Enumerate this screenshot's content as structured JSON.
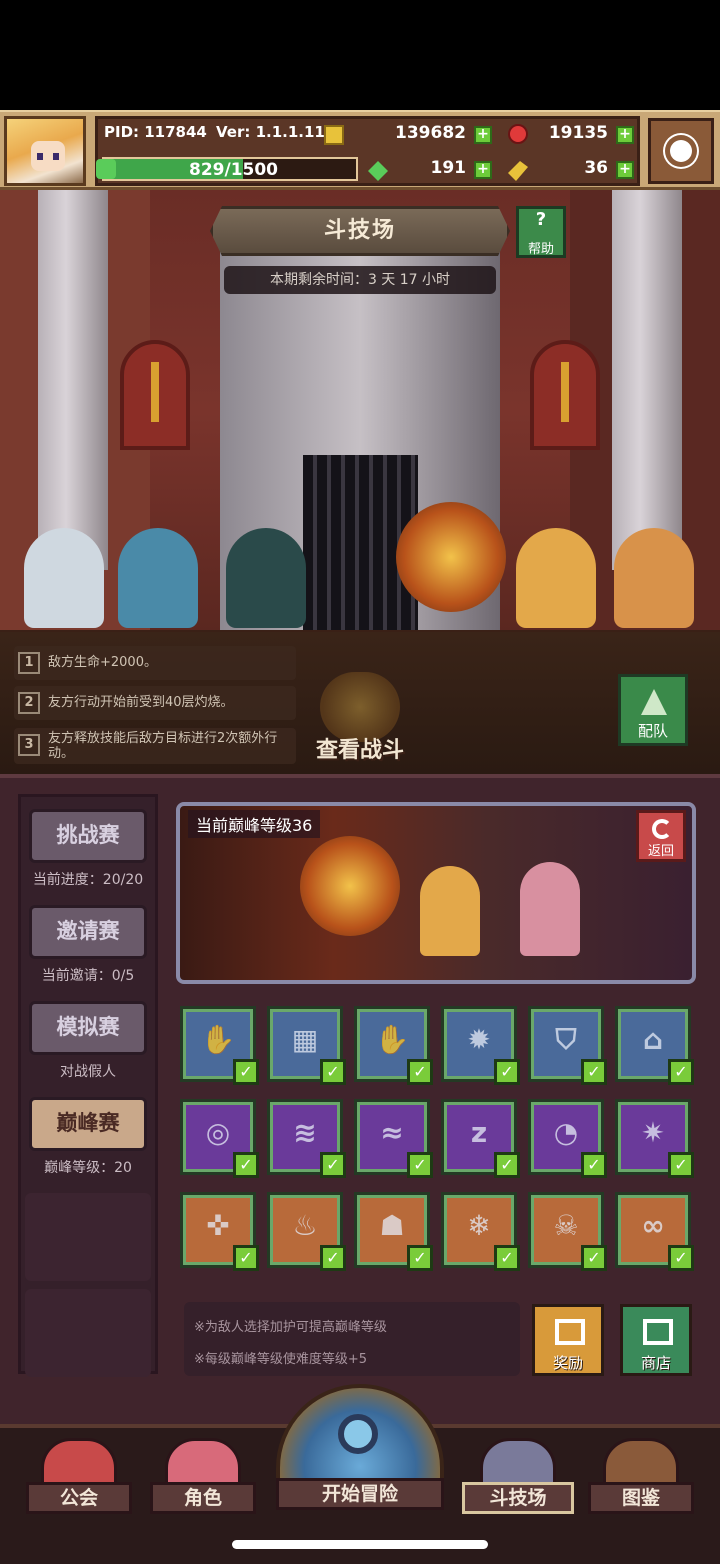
{
  "header": {
    "pid": "PID: 117844",
    "version": "Ver: 1.1.1.11",
    "gold": "139682",
    "gems": "19135",
    "energy": "829/1500",
    "energy_fraction": 0.553,
    "clovers": "191",
    "keys": "36",
    "colors": {
      "gold": "#e8c23a",
      "gem": "#e03a3a",
      "clover": "#5acc5a",
      "energy": "#3fa64a"
    }
  },
  "arena": {
    "title": "斗技场",
    "help_label": "帮助",
    "help_glyph": "?",
    "timer": "本期剩余时间：3 天 17 小时"
  },
  "modifiers": [
    {
      "num": "1",
      "text": "敌方生命+2000。"
    },
    {
      "num": "2",
      "text": "友方行动开始前受到40层灼烧。"
    },
    {
      "num": "3",
      "text": "友方释放技能后敌方目标进行2次额外行动。"
    }
  ],
  "watch_battle": "查看战斗",
  "team_label": "配队",
  "modes": [
    {
      "label": "挑战赛",
      "sub": "当前进度：20/20"
    },
    {
      "label": "邀请赛",
      "sub": "当前邀请：0/5"
    },
    {
      "label": "模拟赛",
      "sub": "对战假人"
    },
    {
      "label": "巅峰赛",
      "sub": "巅峰等级：20",
      "active": true
    }
  ],
  "preview": {
    "level_text": "当前巅峰等级36",
    "return_label": "返回"
  },
  "buffs": [
    [
      {
        "icon": "hand-icon",
        "glyph": "✋",
        "color": "blue"
      },
      {
        "icon": "wall-icon",
        "glyph": "▦",
        "color": "blue"
      },
      {
        "icon": "palm-icon",
        "glyph": "✋",
        "color": "blue"
      },
      {
        "icon": "sun-icon",
        "glyph": "✹",
        "color": "blue"
      },
      {
        "icon": "shield-icon",
        "glyph": "⛉",
        "color": "blue"
      },
      {
        "icon": "tombstone-icon",
        "glyph": "⌂",
        "color": "blue"
      }
    ],
    [
      {
        "icon": "spiral-icon",
        "glyph": "◎",
        "color": "purple"
      },
      {
        "icon": "tornado-icon",
        "glyph": "≋",
        "color": "purple"
      },
      {
        "icon": "waves-icon",
        "glyph": "≈",
        "color": "purple"
      },
      {
        "icon": "sleep-icon",
        "glyph": "z",
        "color": "purple"
      },
      {
        "icon": "blob-icon",
        "glyph": "◔",
        "color": "purple"
      },
      {
        "icon": "star-burst-icon",
        "glyph": "✷",
        "color": "purple"
      }
    ],
    [
      {
        "icon": "bug-icon",
        "glyph": "✜",
        "color": "orange"
      },
      {
        "icon": "fire-icon",
        "glyph": "♨",
        "color": "orange"
      },
      {
        "icon": "ghost-icon",
        "glyph": "☗",
        "color": "orange"
      },
      {
        "icon": "frost-icon",
        "glyph": "❄",
        "color": "orange"
      },
      {
        "icon": "skull-icon",
        "glyph": "☠",
        "color": "orange"
      },
      {
        "icon": "infinity-icon",
        "glyph": "∞",
        "color": "orange"
      }
    ]
  ],
  "check_glyph": "✓",
  "tips": [
    "※为敌人选择加护可提高巅峰等级",
    "※每级巅峰等级使难度等级+5"
  ],
  "reward_label": "奖励",
  "shop_label": "商店",
  "nav": {
    "guild": "公会",
    "character": "角色",
    "adventure": "开始冒险",
    "arena": "斗技场",
    "codex": "图鉴"
  }
}
